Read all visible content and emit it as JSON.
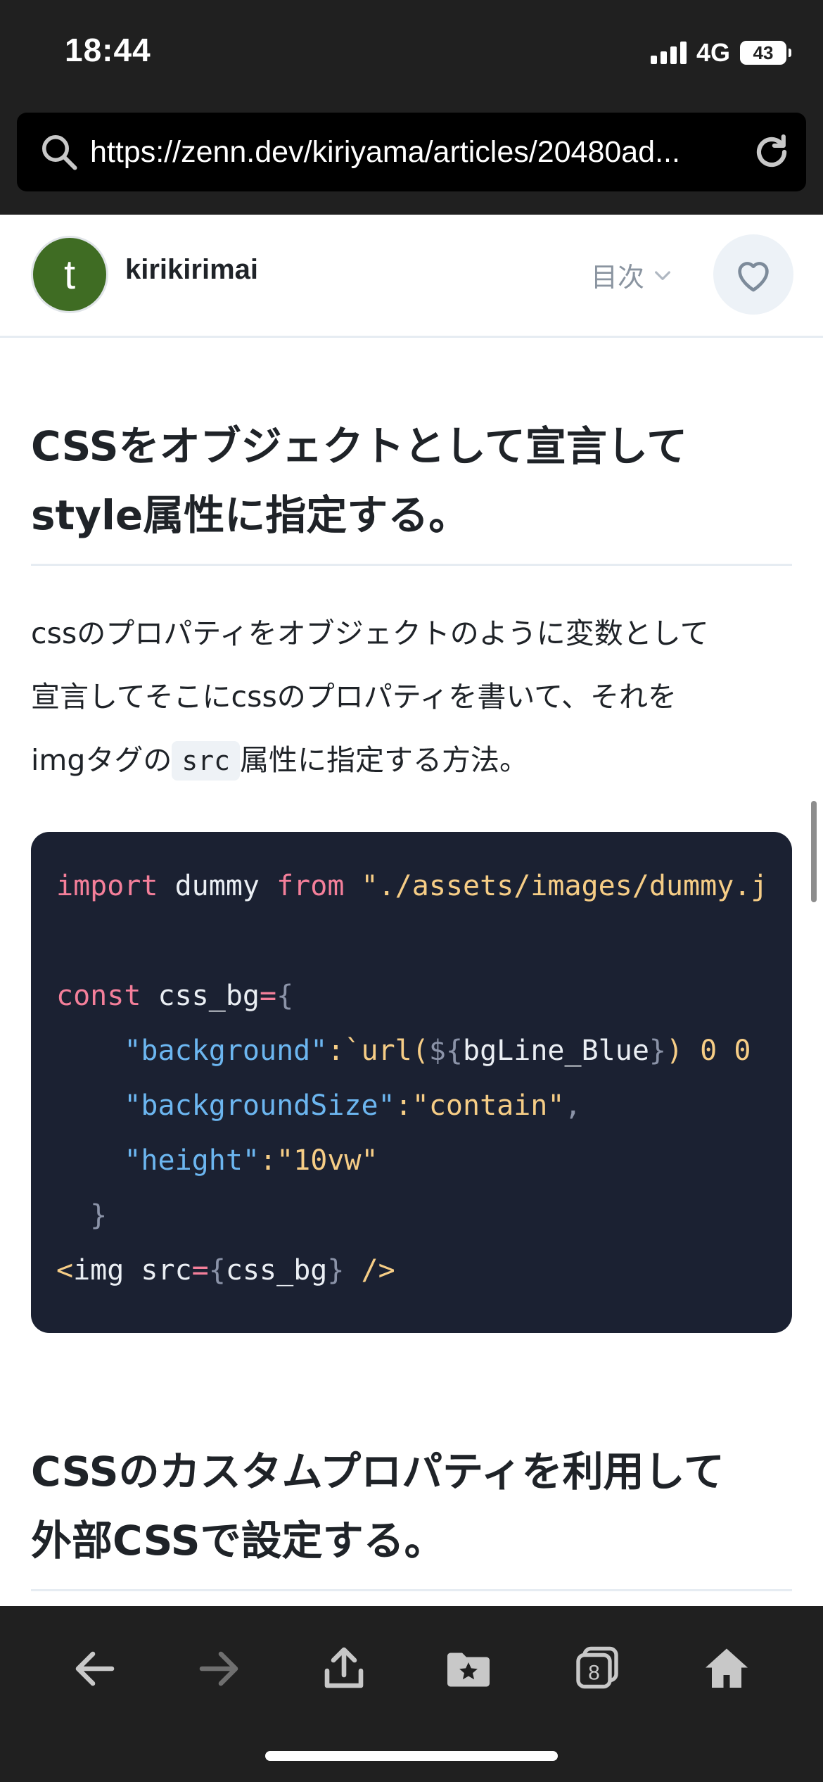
{
  "status_bar": {
    "time": "18:44",
    "network": "4G",
    "battery": "43"
  },
  "browser": {
    "url": "https://zenn.dev/kiriyama/articles/20480ad..."
  },
  "article": {
    "author": {
      "avatar_letter": "t",
      "name": "kirikirimai"
    },
    "toc_label": "目次",
    "heading_1_line1": "CSSをオブジェクトとして宣言して",
    "heading_1_line2": "style属性に指定する。",
    "para_line1": "cssのプロパティをオブジェクトのように変数として",
    "para_line2": "宣言してそこにcssのプロパティを書いて、それを",
    "para_line3_pre": "imgタグの",
    "para_inline_code": "src",
    "para_line3_post": "属性に指定する方法。",
    "code": {
      "l1_kw1": "import",
      "l1_id": " dummy ",
      "l1_kw2": "from",
      "l1_str": " \"./assets/images/dummy.j",
      "l3_kw": "const",
      "l3_id": " css_bg",
      "l3_eq": "=",
      "l3_brace": "{",
      "l4_key": "    \"background\"",
      "l4_colon": ":",
      "l4_tick": "`url(",
      "l4_dollar": "${",
      "l4_var": "bgLine_Blue",
      "l4_close": "}",
      "l4_rest": ") 0 0",
      "l5_key": "    \"backgroundSize\"",
      "l5_colon": ":",
      "l5_val": "\"contain\"",
      "l5_comma": ",",
      "l6_key": "    \"height\"",
      "l6_colon": ":",
      "l6_val": "\"10vw\"",
      "l7_brace": "  }",
      "l8_lt": "<",
      "l8_tag": "img src",
      "l8_eq": "=",
      "l8_ob": "{",
      "l8_var": "css_bg",
      "l8_cb": "}",
      "l8_end": " />"
    },
    "heading_2_line1": "CSSのカスタムプロパティを利用して",
    "heading_2_line2": "外部CSSで設定する。"
  },
  "toolbar": {
    "tabs_count": "8"
  },
  "colors": {
    "chrome_bg": "#202020",
    "code_bg": "#1b2132",
    "avatar_green": "#3f6c23",
    "keyword_pink": "#f47f9a",
    "string_yellow": "#f6cd86",
    "key_blue": "#6cb6f0"
  },
  "icons": [
    "search-icon",
    "reload-icon",
    "chevron-down-icon",
    "heart-icon",
    "back-arrow-icon",
    "forward-arrow-icon",
    "share-icon",
    "bookmarks-icon",
    "tabs-icon",
    "home-icon"
  ]
}
